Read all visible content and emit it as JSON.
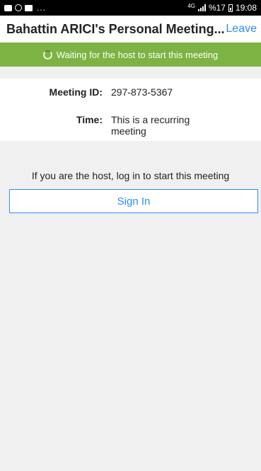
{
  "status_bar": {
    "dots": "...",
    "network": "4G",
    "battery_percent": "%17",
    "time": "19:08"
  },
  "header": {
    "title": "Bahattin ARICI's Personal Meeting...",
    "leave_label": "Leave"
  },
  "banner": {
    "text": "Waiting for the host to start this meeting"
  },
  "meeting": {
    "id_label": "Meeting ID:",
    "id_value": "297-873-5367",
    "time_label": "Time:",
    "time_value": "This is a recurring meeting"
  },
  "host": {
    "prompt": "If you are the host, log in to start this meeting",
    "sign_in_label": "Sign In"
  },
  "colors": {
    "accent": "#2d8cff",
    "banner": "#7cb342"
  }
}
